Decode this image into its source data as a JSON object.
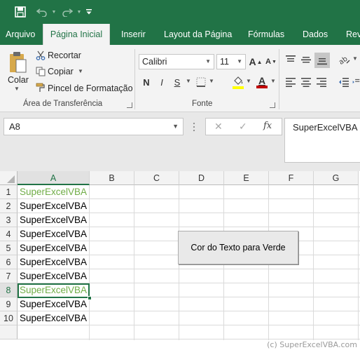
{
  "quick_access": {
    "save_icon": "save-icon",
    "undo_icon": "undo-icon",
    "redo_icon": "redo-icon",
    "customize_icon": "customize-icon"
  },
  "tabs": [
    "Arquivo",
    "Página Inicial",
    "Inserir",
    "Layout da Página",
    "Fórmulas",
    "Dados",
    "Rev"
  ],
  "active_tab": "Página Inicial",
  "clipboard": {
    "paste_label": "Colar",
    "cut_label": "Recortar",
    "copy_label": "Copiar",
    "format_painter_label": "Pincel de Formatação",
    "group_label": "Área de Transferência"
  },
  "font": {
    "family": "Calibri",
    "size": "11",
    "bold": "N",
    "italic": "I",
    "underline": "S",
    "grow_label": "A",
    "shrink_label": "A",
    "font_color_label": "A",
    "group_label": "Fonte"
  },
  "formula_bar": {
    "name_box": "A8",
    "cancel": "✕",
    "enter": "✓",
    "fx": "fx",
    "value": "SuperExcelVBA"
  },
  "columns": [
    "A",
    "B",
    "C",
    "D",
    "E",
    "F",
    "G"
  ],
  "rows": [
    "1",
    "2",
    "3",
    "4",
    "5",
    "6",
    "7",
    "8",
    "9",
    "10",
    ""
  ],
  "cells_A": [
    "SuperExcelVBA",
    "SuperExcelVBA",
    "SuperExcelVBA",
    "SuperExcelVBA",
    "SuperExcelVBA",
    "SuperExcelVBA",
    "SuperExcelVBA",
    "SuperExcelVBA",
    "SuperExcelVBA",
    "SuperExcelVBA"
  ],
  "green_rows": [
    1,
    8
  ],
  "selected_cell": "A8",
  "macro_button_label": "Cor do Texto para Verde",
  "colors": {
    "excel_green": "#217346",
    "text_green": "#70ad47"
  },
  "copyright": "(c) SuperExcelVBA.com"
}
